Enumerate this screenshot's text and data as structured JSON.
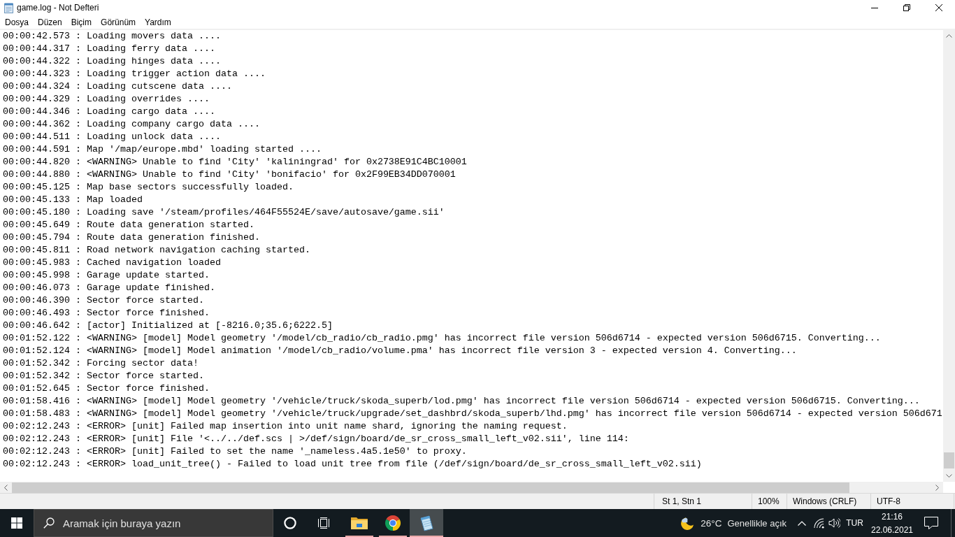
{
  "window": {
    "title": "game.log - Not Defteri"
  },
  "menu": [
    {
      "label": "Dosya"
    },
    {
      "label": "Düzen"
    },
    {
      "label": "Biçim"
    },
    {
      "label": "Görünüm"
    },
    {
      "label": "Yardım"
    }
  ],
  "editor": {
    "lines": [
      "00:00:42.573 : Loading movers data ....",
      "00:00:44.317 : Loading ferry data ....",
      "00:00:44.322 : Loading hinges data ....",
      "00:00:44.323 : Loading trigger action data ....",
      "00:00:44.324 : Loading cutscene data ....",
      "00:00:44.329 : Loading overrides ....",
      "00:00:44.346 : Loading cargo data ....",
      "00:00:44.362 : Loading company cargo data ....",
      "00:00:44.511 : Loading unlock data ....",
      "00:00:44.591 : Map '/map/europe.mbd' loading started ....",
      "00:00:44.820 : <WARNING> Unable to find 'City' 'kaliningrad' for 0x2738E91C4BC10001",
      "00:00:44.880 : <WARNING> Unable to find 'City' 'bonifacio' for 0x2F99EB34DD070001",
      "00:00:45.125 : Map base sectors successfully loaded.",
      "00:00:45.133 : Map loaded",
      "00:00:45.180 : Loading save '/steam/profiles/464F55524E/save/autosave/game.sii'",
      "00:00:45.649 : Route data generation started.",
      "00:00:45.794 : Route data generation finished.",
      "00:00:45.811 : Road network navigation caching started.",
      "00:00:45.983 : Cached navigation loaded",
      "00:00:45.998 : Garage update started.",
      "00:00:46.073 : Garage update finished.",
      "00:00:46.390 : Sector force started.",
      "00:00:46.493 : Sector force finished.",
      "00:00:46.642 : [actor] Initialized at [-8216.0;35.6;6222.5]",
      "00:01:52.122 : <WARNING> [model] Model geometry '/model/cb_radio/cb_radio.pmg' has incorrect file version 506d6714 - expected version 506d6715. Converting...",
      "00:01:52.124 : <WARNING> [model] Model animation '/model/cb_radio/volume.pma' has incorrect file version 3 - expected version 4. Converting...",
      "00:01:52.342 : Forcing sector data!",
      "00:01:52.342 : Sector force started.",
      "00:01:52.645 : Sector force finished.",
      "00:01:58.416 : <WARNING> [model] Model geometry '/vehicle/truck/skoda_superb/lod.pmg' has incorrect file version 506d6714 - expected version 506d6715. Converting...",
      "00:01:58.483 : <WARNING> [model] Model geometry '/vehicle/truck/upgrade/set_dashbrd/skoda_superb/lhd.pmg' has incorrect file version 506d6714 - expected version 506d671",
      "00:02:12.243 : <ERROR> [unit] Failed map insertion into unit name shard, ignoring the naming request.",
      "00:02:12.243 : <ERROR> [unit] File '<../../def.scs | >/def/sign/board/de_sr_cross_small_left_v02.sii', line 114:",
      "00:02:12.243 : <ERROR> [unit] Failed to set the name '_nameless.4a5.1e50' to proxy.",
      "00:02:12.243 : <ERROR> load_unit_tree() - Failed to load unit tree from file (/def/sign/board/de_sr_cross_small_left_v02.sii)"
    ]
  },
  "status_bar": {
    "position": "St 1, Stn 1",
    "zoom": "100%",
    "line_ending": "Windows (CRLF)",
    "encoding": "UTF-8"
  },
  "taskbar": {
    "search": {
      "placeholder": "Aramak için buraya yazın"
    },
    "buttons": [
      {
        "kind": "cortana"
      },
      {
        "kind": "task_view"
      }
    ],
    "apps": [
      {
        "kind": "file_explorer",
        "running": true,
        "selected": false
      },
      {
        "kind": "chrome",
        "running": true,
        "selected": false
      },
      {
        "kind": "notepad",
        "running": true,
        "selected": true
      }
    ],
    "tray": {
      "temperature": "26°C",
      "condition": "Genellikle açık",
      "language": "TUR",
      "time": "21:16",
      "date": "22.06.2021"
    }
  }
}
